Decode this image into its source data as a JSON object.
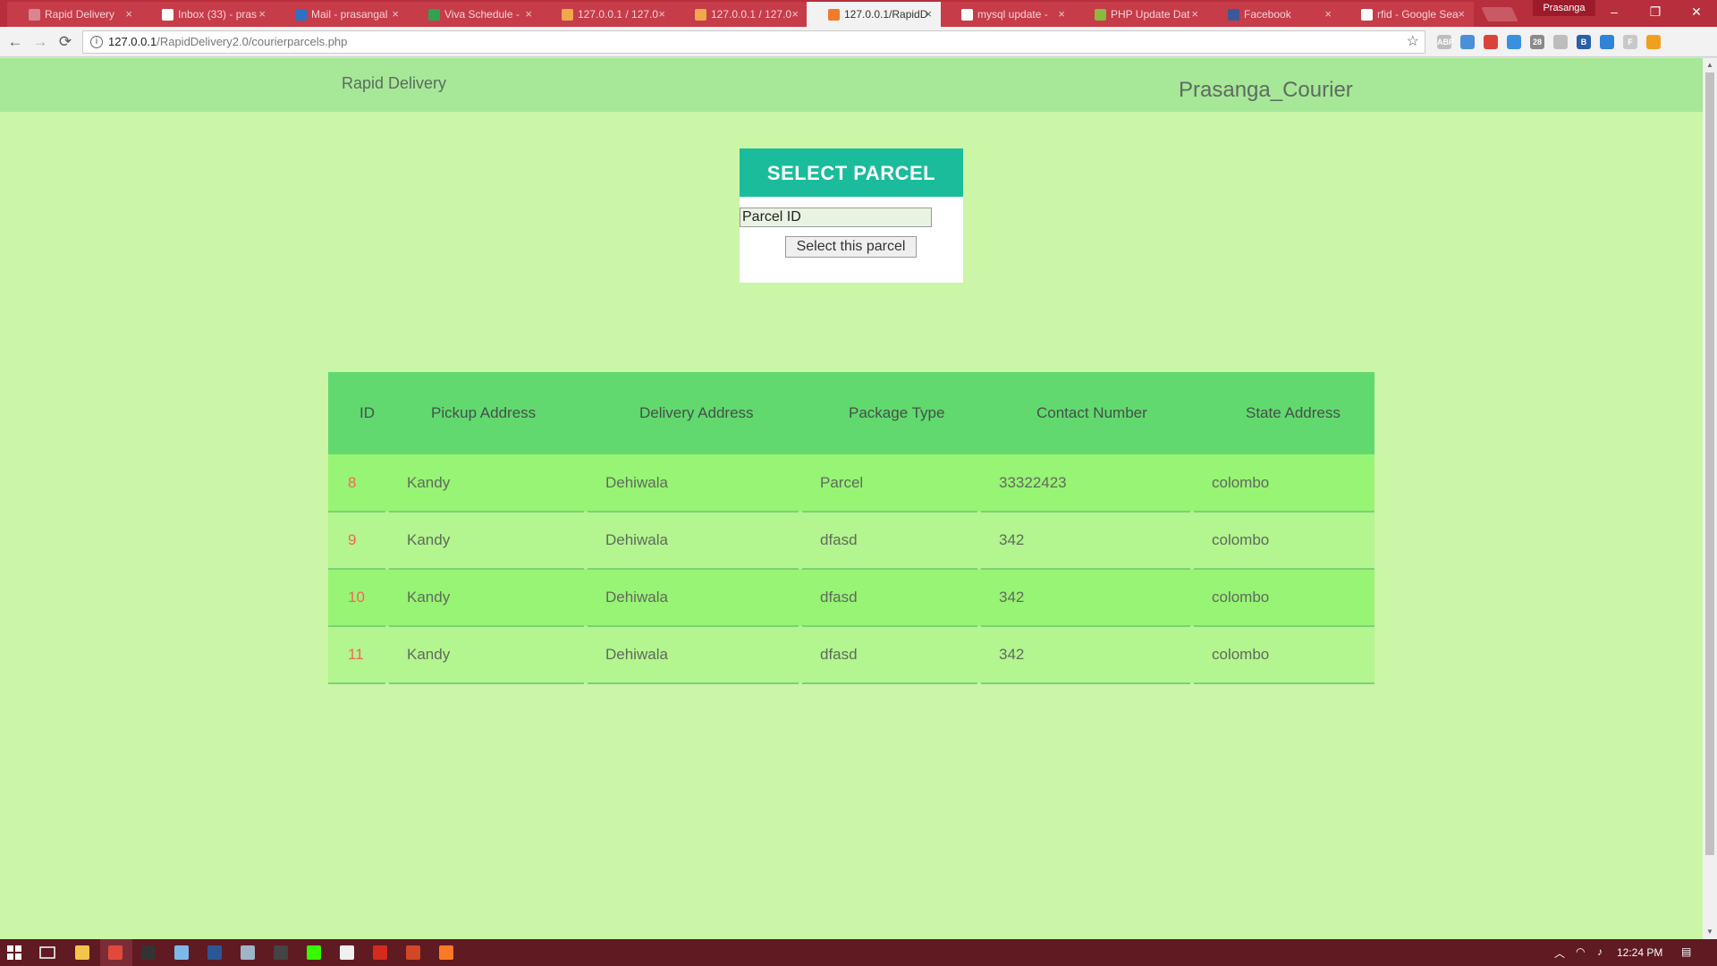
{
  "browser": {
    "tabs": [
      {
        "label": "Rapid Delivery",
        "favicon_color": "#d9868f",
        "active": false
      },
      {
        "label": "Inbox (33) - pras",
        "favicon_color": "#ffffff",
        "active": false
      },
      {
        "label": "Mail - prasangal",
        "favicon_color": "#2a72c9",
        "active": false
      },
      {
        "label": "Viva Schedule -",
        "favicon_color": "#2fa34f",
        "active": false
      },
      {
        "label": "127.0.0.1 / 127.0",
        "favicon_color": "#f0a84a",
        "active": false
      },
      {
        "label": "127.0.0.1 / 127.0",
        "favicon_color": "#f0a84a",
        "active": false
      },
      {
        "label": "127.0.0.1/RapidD",
        "favicon_color": "#f07b2a",
        "active": true
      },
      {
        "label": "mysql update -",
        "favicon_color": "#ffffff",
        "active": false
      },
      {
        "label": "PHP Update Dat",
        "favicon_color": "#8bb83e",
        "active": false
      },
      {
        "label": "Facebook",
        "favicon_color": "#3b5998",
        "active": false
      },
      {
        "label": "rfid - Google Sea",
        "favicon_color": "#ffffff",
        "active": false
      }
    ],
    "close_glyph": "×",
    "profile_name": "Prasanga",
    "window_controls": {
      "minimize": "–",
      "restore": "❐",
      "close": "✕"
    },
    "nav": {
      "back": "←",
      "forward": "→",
      "reload": "⟳"
    },
    "url_host": "127.0.0.1",
    "url_path": "/RapidDelivery2.0/courierparcels.php",
    "info_glyph": "i",
    "star_glyph": "☆",
    "extensions": [
      {
        "label": "ABP",
        "color": "#bdbdbd"
      },
      {
        "label": "",
        "color": "#4a90d9"
      },
      {
        "label": "",
        "color": "#d8443c"
      },
      {
        "label": "",
        "color": "#3a8fe0"
      },
      {
        "label": "28",
        "color": "#8a8a8a"
      },
      {
        "label": "",
        "color": "#bdbdbd"
      },
      {
        "label": "B",
        "color": "#2b5fa8"
      },
      {
        "label": "",
        "color": "#2f83d8"
      },
      {
        "label": "F",
        "color": "#c8c8c8"
      },
      {
        "label": "",
        "color": "#f0a020"
      }
    ]
  },
  "site": {
    "brand": "Rapid Delivery",
    "user_name": "Prasanga_Courier"
  },
  "select_parcel": {
    "title": "SELECT PARCEL",
    "input_placeholder": "Parcel ID",
    "button_label": "Select this parcel"
  },
  "table": {
    "headers": [
      "ID",
      "Pickup Address",
      "Delivery Address",
      "Package Type",
      "Contact Number",
      "State Address"
    ],
    "rows": [
      [
        "8",
        "Kandy",
        "Dehiwala",
        "Parcel",
        "33322423",
        "colombo"
      ],
      [
        "9",
        "Kandy",
        "Dehiwala",
        "dfasd",
        "342",
        "colombo"
      ],
      [
        "10",
        "Kandy",
        "Dehiwala",
        "dfasd",
        "342",
        "colombo"
      ],
      [
        "11",
        "Kandy",
        "Dehiwala",
        "dfasd",
        "342",
        "colombo"
      ]
    ]
  },
  "taskbar": {
    "apps": [
      {
        "name": "file-explorer-icon",
        "color": "#f3c54a"
      },
      {
        "name": "chrome-icon",
        "color": "#e2493b"
      },
      {
        "name": "terminal-icon",
        "color": "#333333"
      },
      {
        "name": "notepad-icon",
        "color": "#7db9e8"
      },
      {
        "name": "word-icon",
        "color": "#2b5797"
      },
      {
        "name": "photos-icon",
        "color": "#9fb4c8"
      },
      {
        "name": "calculator-icon",
        "color": "#444444"
      },
      {
        "name": "dreamweaver-icon",
        "color": "#35fa00"
      },
      {
        "name": "git-icon",
        "color": "#f0f0f0"
      },
      {
        "name": "acrobat-icon",
        "color": "#d52b1e"
      },
      {
        "name": "powerpoint-icon",
        "color": "#d24726"
      },
      {
        "name": "xampp-icon",
        "color": "#fb7a24"
      }
    ],
    "clock": "12:24 PM",
    "tray_up": "︿",
    "tray_network": "◠",
    "tray_volume": "♪",
    "tray_battery": "▭",
    "notification": "▤"
  }
}
